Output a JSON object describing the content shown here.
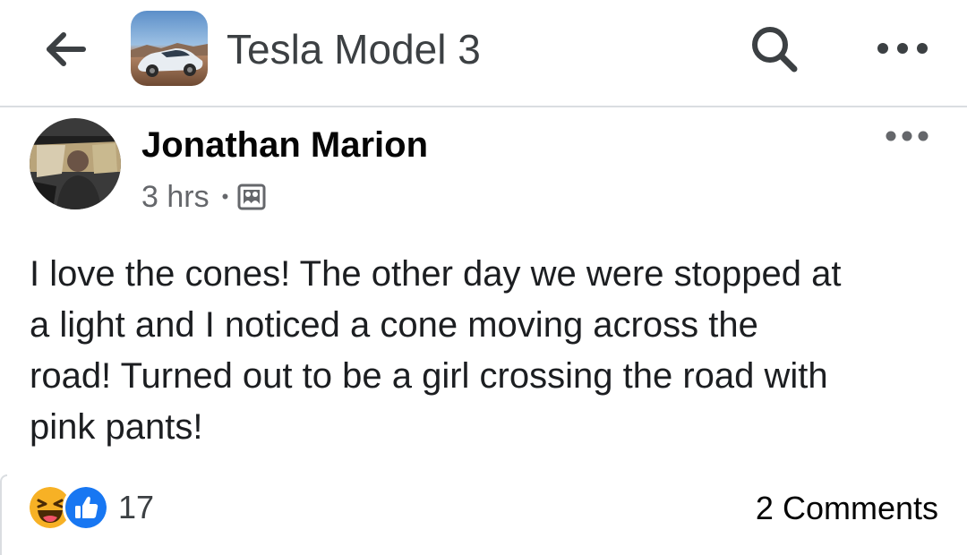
{
  "header": {
    "back_icon": "arrow-left-icon",
    "group_name": "Tesla Model 3",
    "search_icon": "search-icon",
    "more_icon": "more-horizontal-icon"
  },
  "post": {
    "author": "Jonathan Marion",
    "time": "3 hrs",
    "separator": "•",
    "audience_icon": "group-audience-icon",
    "more_icon": "more-horizontal-icon",
    "text_lines": [
      "I love the cones! The other day we were stopped at",
      "a light and I noticed a cone moving across the",
      "road! Turned out to be a girl crossing the road with",
      "pink pants!"
    ]
  },
  "footer": {
    "reaction_icons": [
      "haha-reaction-icon",
      "like-reaction-icon"
    ],
    "reaction_count": "17",
    "comments": "2 Comments"
  },
  "colors": {
    "accent_blue": "#1877f2",
    "secondary_text": "#65676b",
    "divider": "#dadde1"
  }
}
